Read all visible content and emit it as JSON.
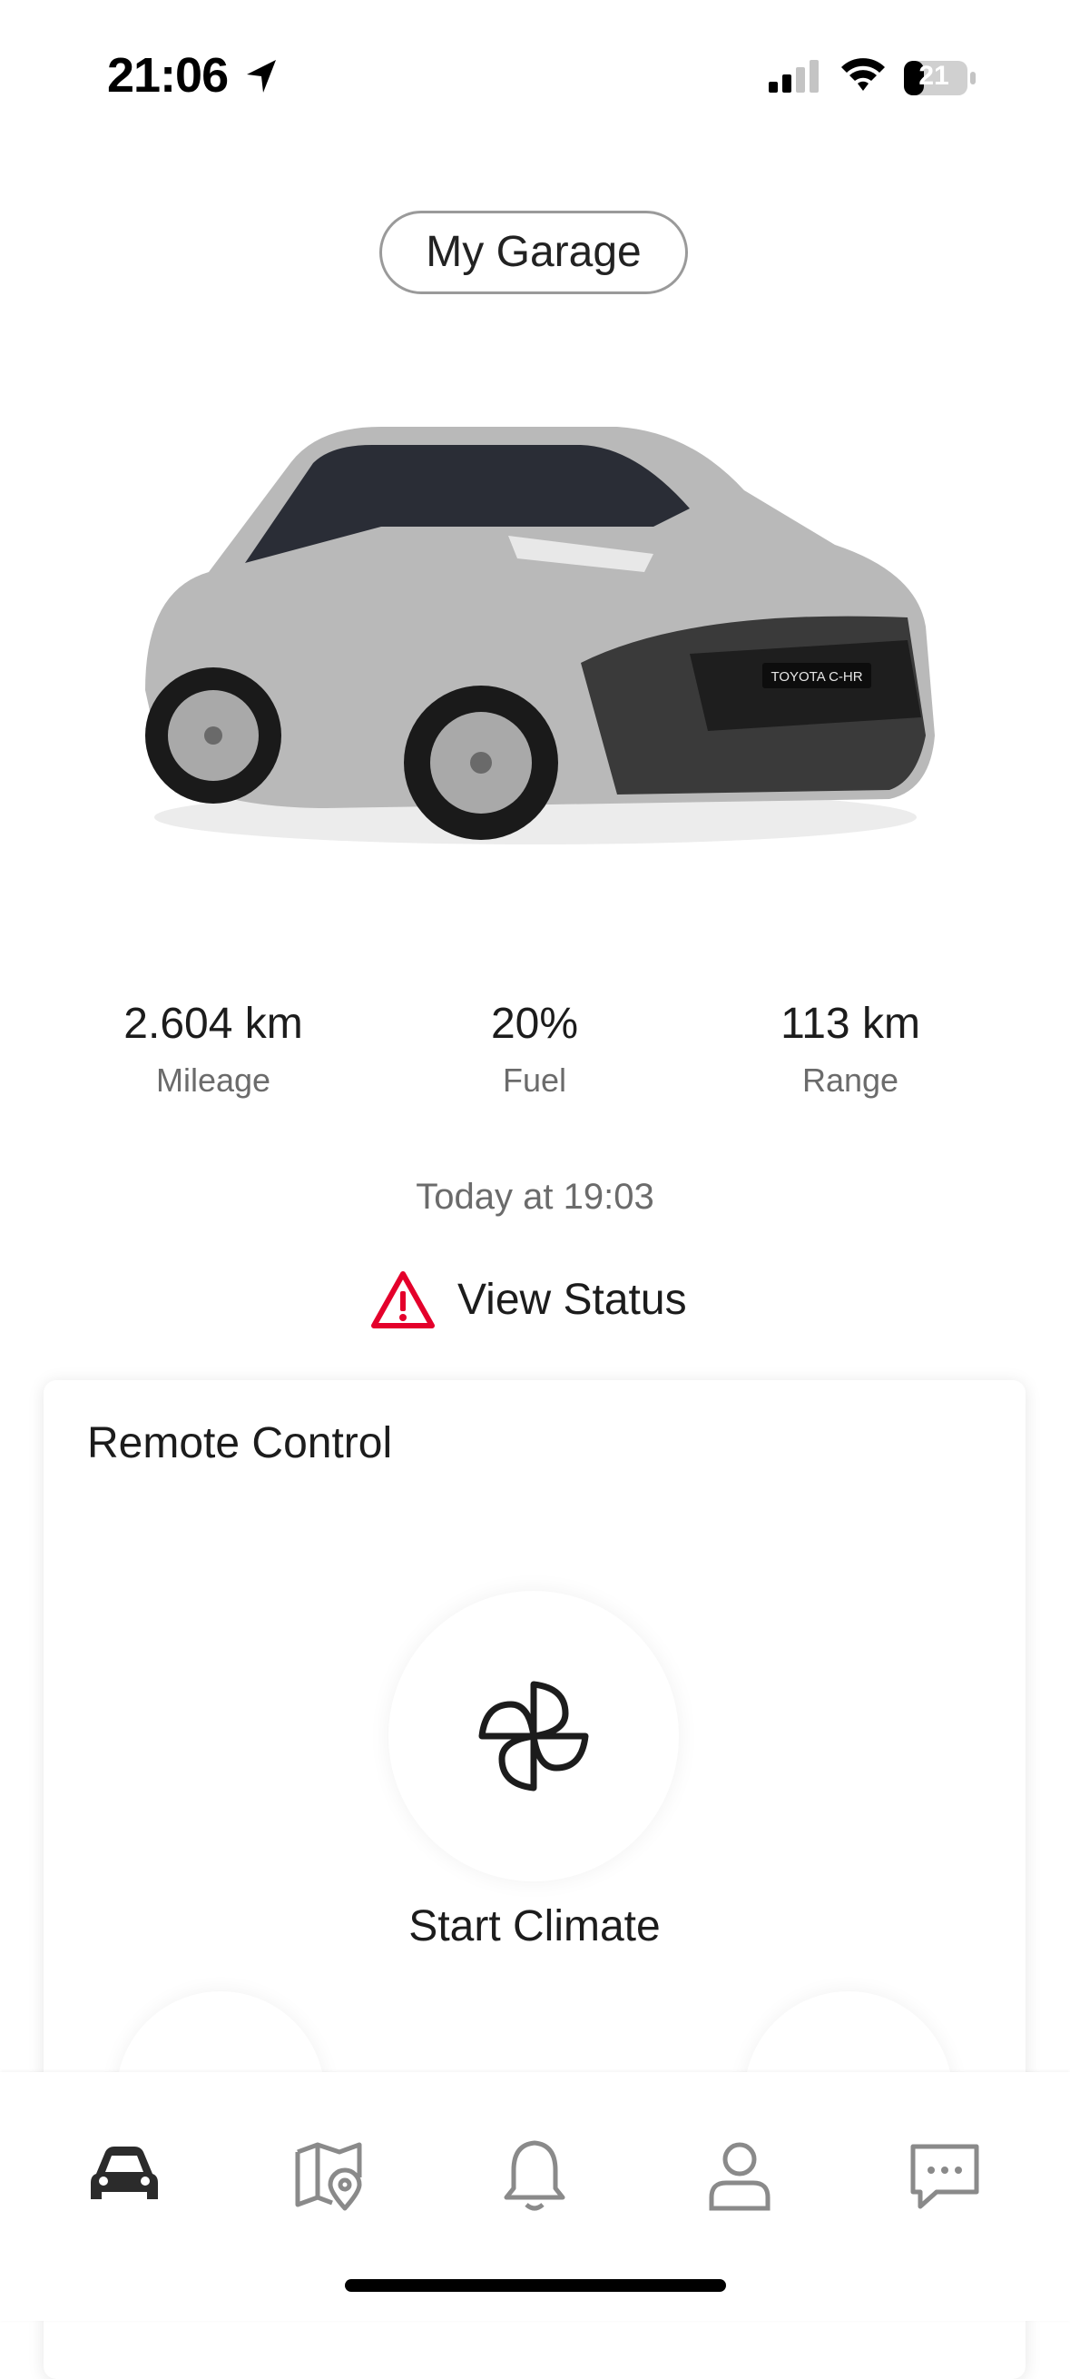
{
  "status_bar": {
    "time": "21:06",
    "battery_level": "21",
    "icons": [
      "location-arrow-icon",
      "cellular-signal-icon",
      "wifi-icon",
      "battery-icon"
    ]
  },
  "header": {
    "garage_button": "My Garage"
  },
  "vehicle": {
    "image_label": "TOYOTA C-HR",
    "image_color": "#b9b9b9"
  },
  "stats": [
    {
      "value": "2.604 km",
      "label": "Mileage"
    },
    {
      "value": "20%",
      "label": "Fuel"
    },
    {
      "value": "113 km",
      "label": "Range"
    }
  ],
  "status": {
    "updated": "Today at 19:03",
    "view_status": "View Status",
    "warning_color": "#e4002b"
  },
  "remote_control": {
    "title": "Remote Control",
    "climate_label": "Start Climate"
  },
  "tab_bar": {
    "items": [
      {
        "icon": "car-icon",
        "active": true
      },
      {
        "icon": "map-icon",
        "active": false
      },
      {
        "icon": "bell-icon",
        "active": false
      },
      {
        "icon": "person-icon",
        "active": false
      },
      {
        "icon": "chat-icon",
        "active": false
      }
    ],
    "active_color": "#2b2b2b",
    "inactive_color": "#8a8a8a"
  }
}
